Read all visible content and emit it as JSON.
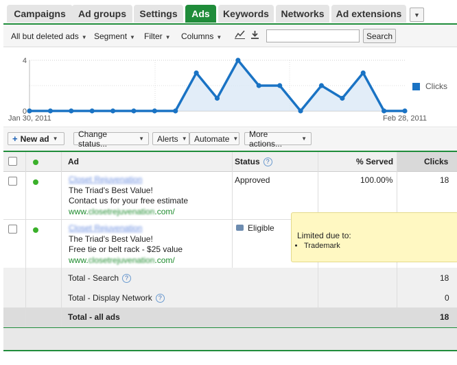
{
  "tabs": [
    {
      "label": "Campaigns",
      "active": false
    },
    {
      "label": "Ad groups",
      "active": false
    },
    {
      "label": "Settings",
      "active": false
    },
    {
      "label": "Ads",
      "active": true
    },
    {
      "label": "Keywords",
      "active": false
    },
    {
      "label": "Networks",
      "active": false
    },
    {
      "label": "Ad extensions",
      "active": false
    }
  ],
  "toolbar": {
    "filter_ads": "All but deleted ads",
    "segment": "Segment",
    "filter": "Filter",
    "columns": "Columns",
    "search_value": "",
    "search_button": "Search"
  },
  "chart": {
    "y_max_label": "4",
    "y_min_label": "0",
    "start_date": "Jan 30, 2011",
    "end_date": "Feb 28, 2011",
    "legend": "Clicks",
    "color": "#1a73c4",
    "values": [
      0,
      0,
      0,
      0,
      0,
      0,
      0,
      0,
      3,
      1,
      4,
      2,
      2,
      0,
      2,
      1,
      3,
      0,
      0
    ]
  },
  "actions": {
    "new_ad": "New ad",
    "change_status": "Change status...",
    "alerts": "Alerts",
    "automate": "Automate",
    "more_actions": "More actions..."
  },
  "table": {
    "headers": {
      "ad": "Ad",
      "status": "Status",
      "served": "% Served",
      "clicks": "Clicks"
    },
    "rows": [
      {
        "headline": "Closet Rejuvenation",
        "line1": "The Triad's Best Value!",
        "line2": "Contact us for your free estimate",
        "url_prefix": "www.",
        "url_blur": "closetrejuvenation",
        "url_suffix": ".com/",
        "status": "Approved",
        "served": "100.00%",
        "clicks": "18"
      },
      {
        "headline": "Closet Rejuvenation",
        "line1": "The Triad's Best Value!",
        "line2": "Free tie or belt rack - $25 value",
        "url_prefix": "www.",
        "url_blur": "closetrejuvenation",
        "url_suffix": ".com/",
        "status": "Eligible",
        "served": "",
        "clicks": ""
      }
    ],
    "totals": [
      {
        "label": "Total - Search",
        "clicks": "18"
      },
      {
        "label": "Total - Display Network",
        "clicks": "0"
      },
      {
        "label": "Total - all ads",
        "clicks": "18"
      }
    ]
  },
  "tooltip": {
    "title": "Limited due to:",
    "item": "Trademark"
  }
}
